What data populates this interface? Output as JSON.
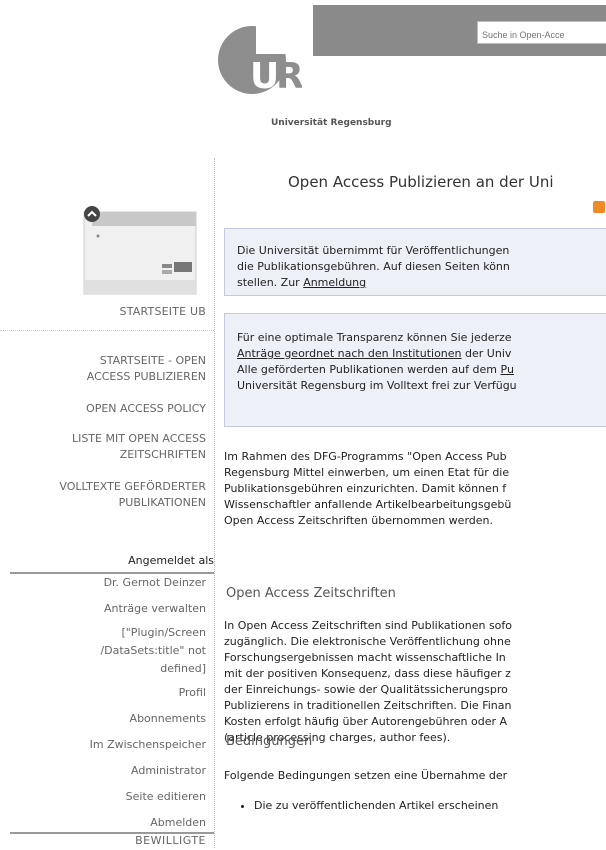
{
  "header": {
    "search_placeholder": "Suche in Open-Acce",
    "logo_letters": "UR",
    "university": "Universität Regensburg"
  },
  "sidebar": {
    "startseite_ub": "STARTSEITE UB",
    "nav": [
      {
        "line1": "STARTSEITE - OPEN",
        "line2": "ACCESS PUBLIZIEREN"
      },
      {
        "line1": "OPEN ACCESS POLICY",
        "line2": ""
      },
      {
        "line1": "LISTE MIT OPEN ACCESS",
        "line2": "ZEITSCHRIFTEN"
      },
      {
        "line1": "VOLLTEXTE GEFÖRDERTER",
        "line2": "PUBLIKATIONEN"
      }
    ],
    "logged_in_label": "Angemeldet als",
    "account": [
      "Dr. Gernot Deinzer",
      "Anträge verwalten",
      "[\"Plugin/Screen",
      "/DataSets:title\" not",
      "defined]",
      "Profil",
      "Abonnements",
      "Im Zwischenspeicher",
      "Administrator",
      "Seite editieren",
      "Abmelden",
      "BEWILLIGTE"
    ]
  },
  "main": {
    "title": "Open Access Publizieren an der Uni",
    "box1": {
      "line1": "Die Universität übernimmt für Veröffentlichungen",
      "line2": "die Publikationsgebühren. Auf diesen Seiten könn",
      "line3_pre": "stellen. Zur ",
      "line3_link": "Anmeldung"
    },
    "box2": {
      "line1": "Für eine optimale Transparenz können Sie jederze",
      "line2_link": "Anträge geordnet nach den Institutionen",
      "line2_post": " der Univ",
      "line3_pre": "Alle geförderten Publikationen werden auf dem ",
      "line3_link": "Pu",
      "line4": "Universität Regensburg im Volltext frei zur Verfügu"
    },
    "intro": [
      "Im Rahmen des DFG-Programms \"Open Access Pub",
      "Regensburg Mittel einwerben, um einen Etat für die",
      "Publikationsgebühren einzurichten. Damit können f",
      "Wissenschaftler anfallende Artikelbearbeitungsgebü",
      "Open Access Zeitschriften übernommen werden."
    ],
    "section1_title": "Open Access Zeitschriften",
    "section1": [
      "In Open Access Zeitschriften sind Publikationen sofo",
      "zugänglich. Die elektronische Veröffentlichung ohne",
      "Forschungsergebnissen macht wissenschaftliche In",
      "mit der positiven Konsequenz, dass diese häufiger z",
      "der Einreichungs- sowie der Qualitätssicherungspro",
      "Publizierens in traditionellen Zeitschriften. Die Finan",
      "Kosten erfolgt häufig über Autorengebühren oder A",
      "(article processing charges, author fees)."
    ],
    "section2_title": "Bedingungen",
    "section2_intro": "Folgende Bedingungen setzen eine Übernahme der",
    "bullet1": "Die zu veröffentlichenden Artikel erscheinen"
  },
  "colors": {
    "topbar": "#8a8a8a",
    "box_bg": "#eef0f8",
    "rss": "#f08a24"
  },
  "icons": [
    "rss-icon",
    "ub-page-icon",
    "ur-logo"
  ]
}
